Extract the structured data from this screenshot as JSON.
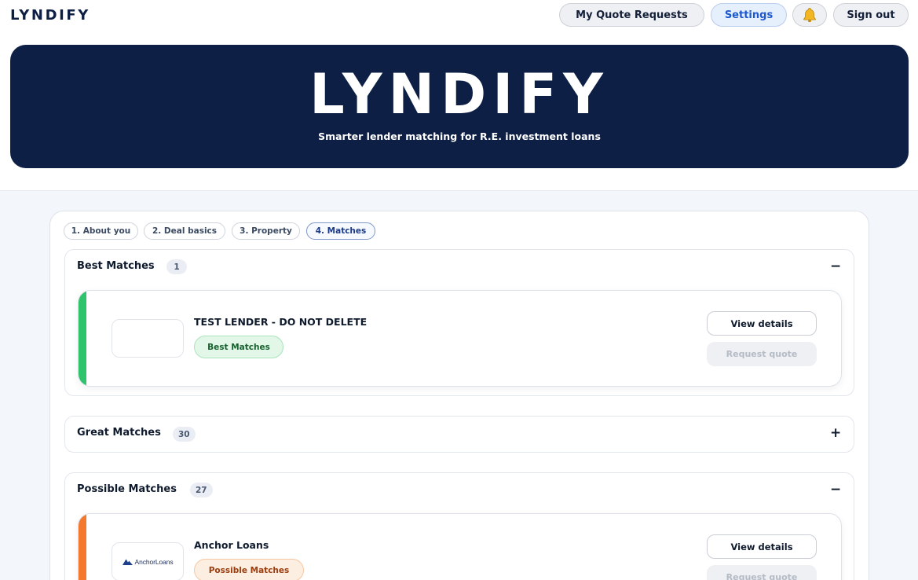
{
  "topnav": {
    "brand": "LYNDIFY",
    "my_quote_requests": "My Quote Requests",
    "settings": "Settings",
    "bell_icon": "bell-icon",
    "sign_out": "Sign out"
  },
  "hero": {
    "title": "LYNDIFY",
    "subtitle": "Smarter lender matching for R.E. investment loans"
  },
  "steps": [
    {
      "label": "1. About you",
      "active": false
    },
    {
      "label": "2. Deal basics",
      "active": false
    },
    {
      "label": "3. Property",
      "active": false
    },
    {
      "label": "4. Matches",
      "active": true
    }
  ],
  "sections": {
    "best": {
      "title": "Best Matches",
      "count": "1",
      "toggle": "−",
      "lenders": [
        {
          "name": "TEST LENDER - DO NOT DELETE",
          "pill": "Best Matches",
          "view_details": "View details",
          "request_quote": "Request quote"
        }
      ]
    },
    "great": {
      "title": "Great Matches",
      "count": "30",
      "toggle": "+"
    },
    "possible": {
      "title": "Possible Matches",
      "count": "27",
      "toggle": "−",
      "lenders": [
        {
          "name": "Anchor Loans",
          "logo_text": "AnchorLoans",
          "pill": "Possible Matches",
          "view_details": "View details",
          "request_quote": "Request quote"
        }
      ]
    }
  },
  "colors": {
    "navy": "#0d1f45",
    "settings_blue": "#1d58cf",
    "best_accent": "#2fc36b",
    "possible_accent": "#f4782e"
  }
}
